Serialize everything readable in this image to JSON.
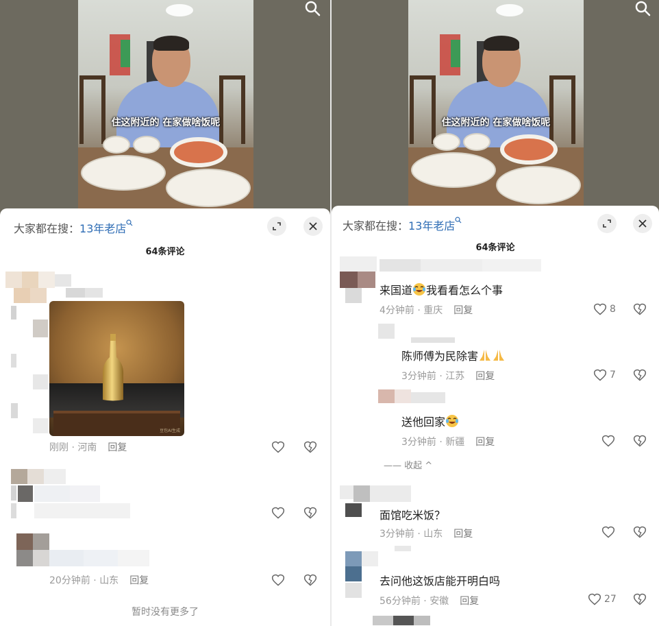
{
  "video": {
    "caption": "住这附近的 在家做啥饭呢"
  },
  "sheet": {
    "hot_search_prefix": "大家都在搜：",
    "hot_search_keyword": "13年老店",
    "comment_count": "64条评论"
  },
  "left": {
    "comments": [
      {
        "time": "刚刚",
        "location": "河南",
        "reply": "回复",
        "has_image": true
      },
      {
        "reply": ""
      },
      {
        "time": "20分钟前",
        "location": "山东",
        "reply": "回复"
      }
    ],
    "no_more": "暂时没有更多了",
    "image_watermark": "豆包AI生成"
  },
  "right": {
    "comments": [
      {
        "text": "来国道",
        "text_after": "我看看怎么个事",
        "time": "4分钟前",
        "location": "重庆",
        "reply": "回复",
        "likes": "8"
      },
      {
        "text": "陈师傅为民除害",
        "time": "3分钟前",
        "location": "江苏",
        "reply": "回复",
        "likes": "7"
      },
      {
        "text": "送他回家",
        "time": "3分钟前",
        "location": "新疆",
        "reply": "回复",
        "likes": ""
      },
      {
        "text": "面馆吃米饭？",
        "time": "3分钟前",
        "location": "山东",
        "reply": "回复",
        "likes": ""
      },
      {
        "text": "去问他这饭店能开明白吗",
        "time": "56分钟前",
        "location": "安徽",
        "reply": "回复",
        "likes": "27"
      }
    ],
    "collapse": "—— 收起 ^"
  },
  "meta_separator": " · ",
  "icons": {
    "search": "search-icon",
    "expand": "expand-icon",
    "close": "close-icon",
    "like": "heart-outline-icon",
    "dislike": "broken-heart-icon"
  },
  "colors": {
    "keyword": "#2f6db5",
    "meta": "#9a9a9a"
  }
}
